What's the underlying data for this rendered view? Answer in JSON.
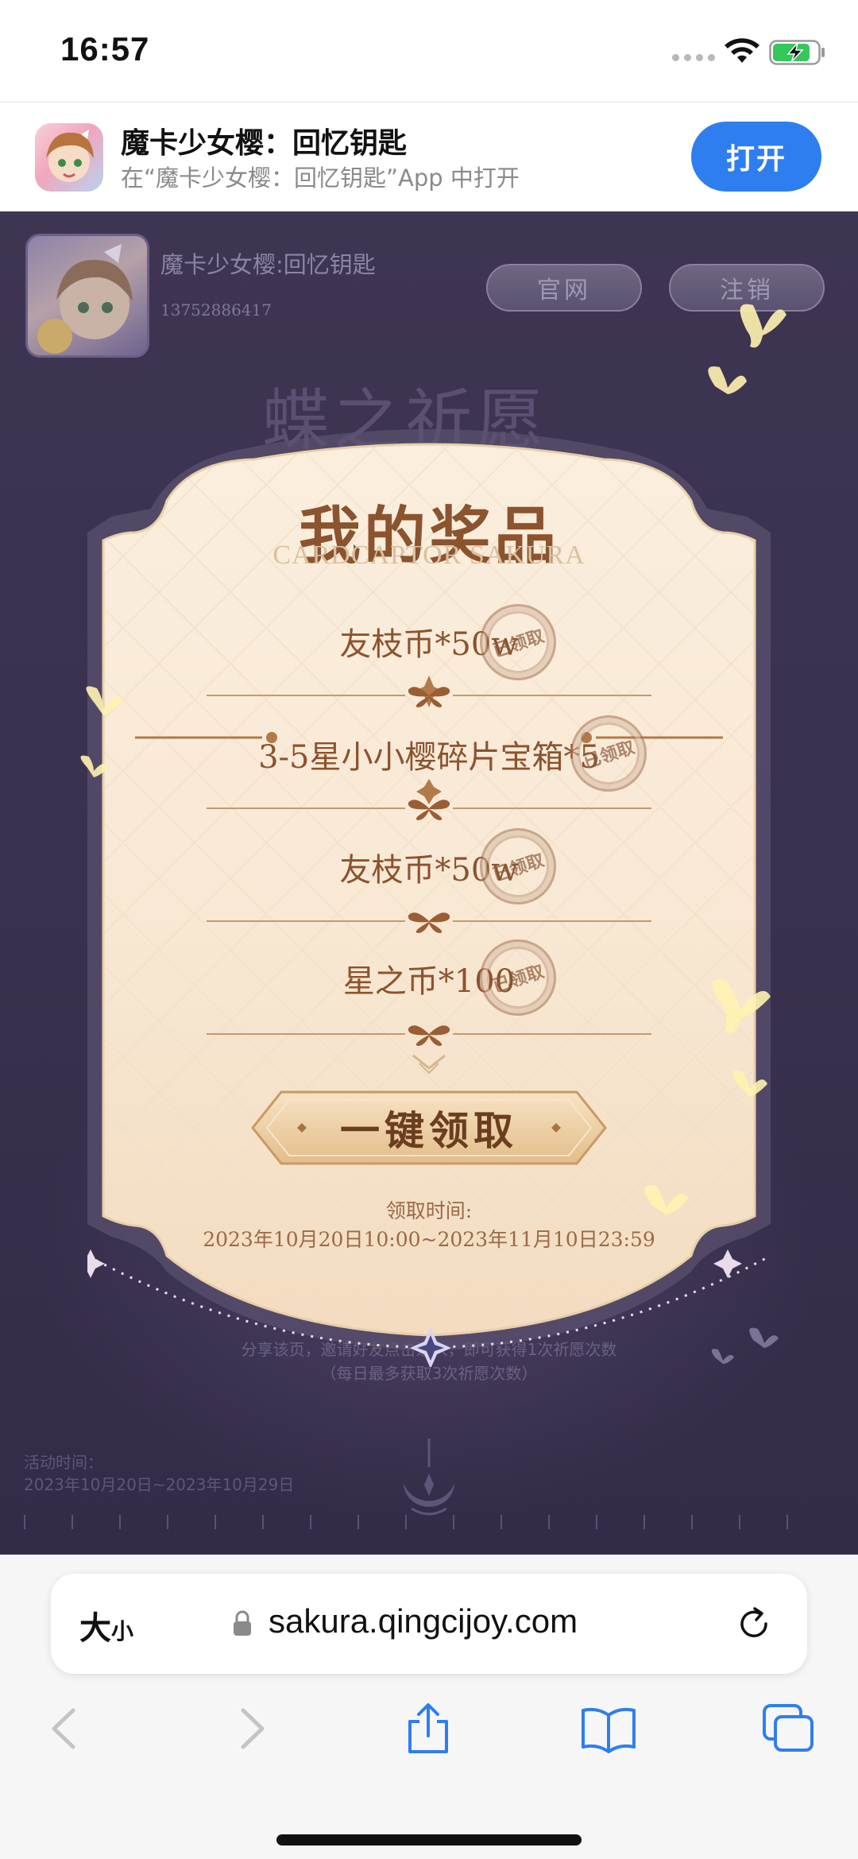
{
  "status_bar": {
    "time": "16:57"
  },
  "app_banner": {
    "title": "魔卡少女樱：回忆钥匙",
    "subtitle": "在“魔卡少女樱：回忆钥匙”App 中打开",
    "open_label": "打开"
  },
  "header": {
    "game_name": "魔卡少女樱:回忆钥匙",
    "phone": "13752886417",
    "site_label": "官网",
    "logout_label": "注销"
  },
  "background": {
    "heading": "蝶之祈愿",
    "share_line1": "分享该页，邀请好友点击进入，即可获得1次祈愿次数",
    "share_line2": "（每日最多获取3次祈愿次数）",
    "activity_label": "活动时间：",
    "activity_dates": "2023年10月20日~2023年10月29日"
  },
  "modal": {
    "title": "我的奖品",
    "subtitle": "CARDCAPTOR SAKURA",
    "prizes": [
      {
        "name": "友枝币*50w",
        "status": "已领取"
      },
      {
        "name": "3-5星小小樱碎片宝箱*5",
        "status": "已领取"
      },
      {
        "name": "友枝币*50w",
        "status": "已领取"
      },
      {
        "name": "星之币*100",
        "status": "已领取"
      }
    ],
    "claim_all_label": "一键领取",
    "claim_time_label": "领取时间:",
    "claim_time_range": "2023年10月20日10:00~2023年11月10日23:59"
  },
  "safari": {
    "text_size_big": "大",
    "text_size_small": "小",
    "url": "sakura.qingcijoy.com"
  }
}
